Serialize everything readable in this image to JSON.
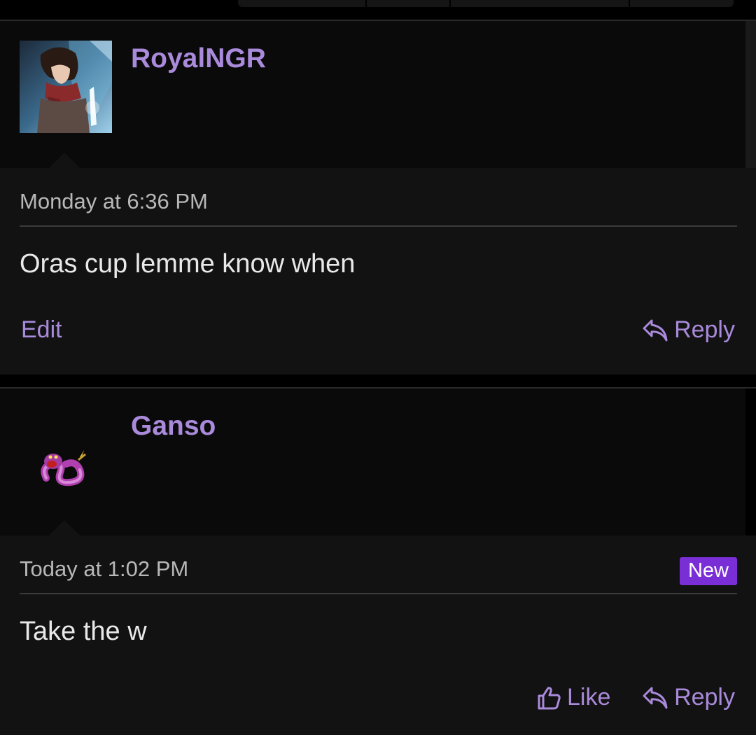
{
  "posts": [
    {
      "username": "RoyalNGR",
      "avatar_icon": "anime-character-avatar",
      "timestamp": "Monday at 6:36 PM",
      "message": "Oras cup lemme know when",
      "actions": {
        "edit_label": "Edit",
        "reply_label": "Reply"
      }
    },
    {
      "username": "Ganso",
      "avatar_icon": "snake-sprite-avatar",
      "timestamp": "Today at 1:02 PM",
      "badge": "New",
      "message": "Take the w",
      "actions": {
        "like_label": "Like",
        "reply_label": "Reply"
      }
    }
  ],
  "colors": {
    "accent": "#a98adb",
    "badge": "#7a2ed6",
    "background": "#000000",
    "post_body": "#121212",
    "user_block": "#0a0a0a"
  }
}
